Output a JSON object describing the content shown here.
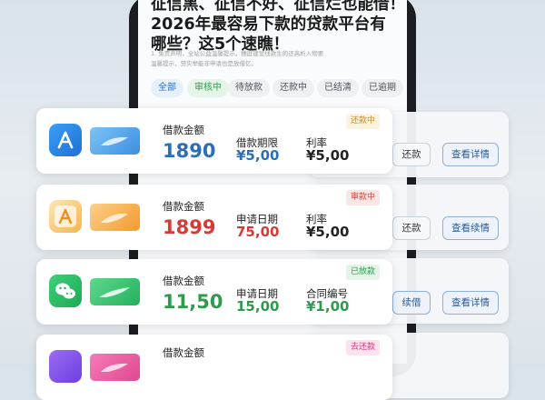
{
  "article": {
    "title_lines": [
      "征信黑、征信不好、征信烂也能借！",
      "2026年最容易下款的贷款平台有",
      "哪些？这5个速瞧！"
    ],
    "subtitle_lines": [
      "1. 免责声明，全站公益温馨提示。穗庭建营线款生的还高析入物要",
      "温馨提示，贷实举能非申请也是放借忆。"
    ]
  },
  "tabs": [
    "全部",
    "审核中",
    "待放款",
    "还款中",
    "已结清",
    "已逾期"
  ],
  "back_buttons": [
    {
      "left": "还款",
      "right": "查看详情"
    },
    {
      "left": "还款",
      "right": "查看续情"
    },
    {
      "left": "续借",
      "right": "查看详情"
    }
  ],
  "cards": [
    {
      "amount_label": "借款金额",
      "amount": "1890",
      "col2_label": "借款期限",
      "col2_value": "¥5,00",
      "col3_label": "利率",
      "col3_value": "¥5,00",
      "status": "还款中",
      "amount_color": "#2a6fb8",
      "col2_color": "#2a6fb8",
      "col3_color": "#222222",
      "badge_bg": "#fdf2dc",
      "badge_fg": "#d08a1c"
    },
    {
      "amount_label": "借款金额",
      "amount": "1899",
      "col2_label": "申请日期",
      "col2_value": "75,00",
      "col3_label": "利率",
      "col3_value": "¥5,00",
      "status": "审款中",
      "amount_color": "#d63a35",
      "col2_color": "#d63a35",
      "col3_color": "#222222",
      "badge_bg": "#fde5e3",
      "badge_fg": "#d6453f"
    },
    {
      "amount_label": "借款金额",
      "amount": "11,50",
      "col2_label": "申请日期",
      "col2_value": "15,00",
      "col3_label": "合同编号",
      "col3_value": "¥1,00",
      "status": "已放款",
      "amount_color": "#2e9a4e",
      "col2_color": "#2e9a4e",
      "col3_color": "#2e9a4e",
      "badge_bg": "#e3f5e7",
      "badge_fg": "#2e9a4e"
    },
    {
      "amount_label": "借款金额",
      "amount": "",
      "col2_label": "",
      "col2_value": "",
      "col3_label": "",
      "col3_value": "",
      "status": "去还款",
      "amount_color": "#222222",
      "col2_color": "#222222",
      "col3_color": "#222222",
      "badge_bg": "#fde3ee",
      "badge_fg": "#d83a78"
    }
  ]
}
